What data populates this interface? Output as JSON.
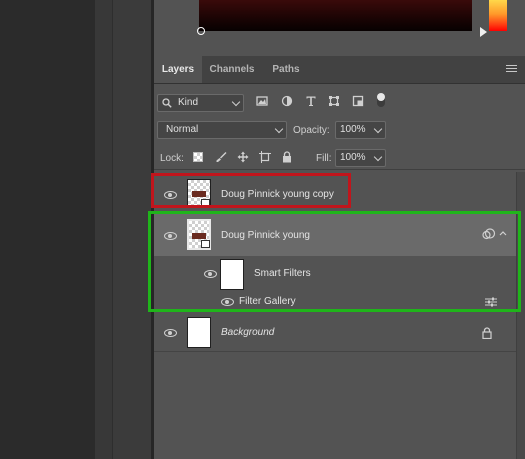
{
  "colors": {
    "panel_bg": "#535353",
    "selected_row_bg": "#6a6a6a",
    "annotation_red": "#c1151c",
    "annotation_green": "#1fb51a"
  },
  "tabs": [
    {
      "label": "Layers",
      "active": true
    },
    {
      "label": "Channels",
      "active": false
    },
    {
      "label": "Paths",
      "active": false
    }
  ],
  "filter": {
    "kind_value": "Kind",
    "icons": [
      "pixel-filter-icon",
      "adjustment-filter-icon",
      "type-filter-icon",
      "shape-filter-icon",
      "smartobject-filter-icon",
      "filter-toggle-icon"
    ]
  },
  "blend": {
    "mode_value": "Normal",
    "opacity_label": "Opacity:",
    "opacity_value": "100%"
  },
  "lock": {
    "label": "Lock:",
    "fill_label": "Fill:",
    "fill_value": "100%",
    "icons": [
      "lock-transparent-icon",
      "lock-image-icon",
      "lock-position-icon",
      "lock-artboard-icon",
      "lock-all-icon"
    ]
  },
  "layers": [
    {
      "name": "Doug Pinnick young copy",
      "visible": true,
      "smart_object": true
    },
    {
      "name": "Doug Pinnick young",
      "visible": true,
      "smart_object": true,
      "selected": true,
      "smart_filters_label": "Smart Filters",
      "filter_gallery_label": "Filter Gallery"
    },
    {
      "name": "Background",
      "visible": true,
      "locked": true,
      "italic": true
    }
  ]
}
